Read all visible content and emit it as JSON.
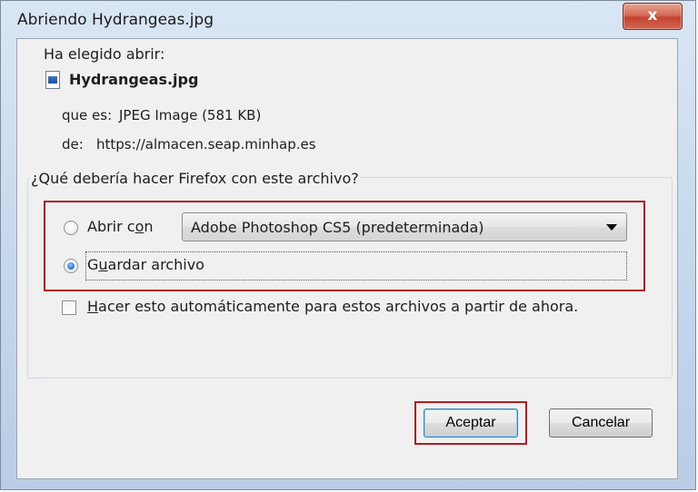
{
  "window": {
    "title": "Abriendo Hydrangeas.jpg",
    "close_label": "x"
  },
  "dialog": {
    "intro": "Ha elegido abrir:",
    "file_name": "Hydrangeas.jpg",
    "type_label": "que es:",
    "type_value": "JPEG Image (581 KB)",
    "from_label": "de:",
    "from_value": "https://almacen.seap.minhap.es",
    "question": "¿Qué debería hacer Firefox con este archivo?",
    "open_with": {
      "label_prefix": "Abrir c",
      "label_mnemonic": "o",
      "label_suffix": "n",
      "selected": false
    },
    "app_select_value": "Adobe Photoshop CS5 (predeterminada)",
    "save_file": {
      "label_prefix": "G",
      "label_mnemonic": "u",
      "label_suffix": "ardar archivo",
      "selected": true
    },
    "auto_checkbox": {
      "label_prefix": "",
      "label_mnemonic": "H",
      "label_suffix": "acer esto automáticamente para estos archivos a partir de ahora.",
      "checked": false
    },
    "ok_label": "Aceptar",
    "cancel_label": "Cancelar"
  },
  "colors": {
    "highlight_red": "#b01c24",
    "radio_accent": "#2a6cc9"
  }
}
